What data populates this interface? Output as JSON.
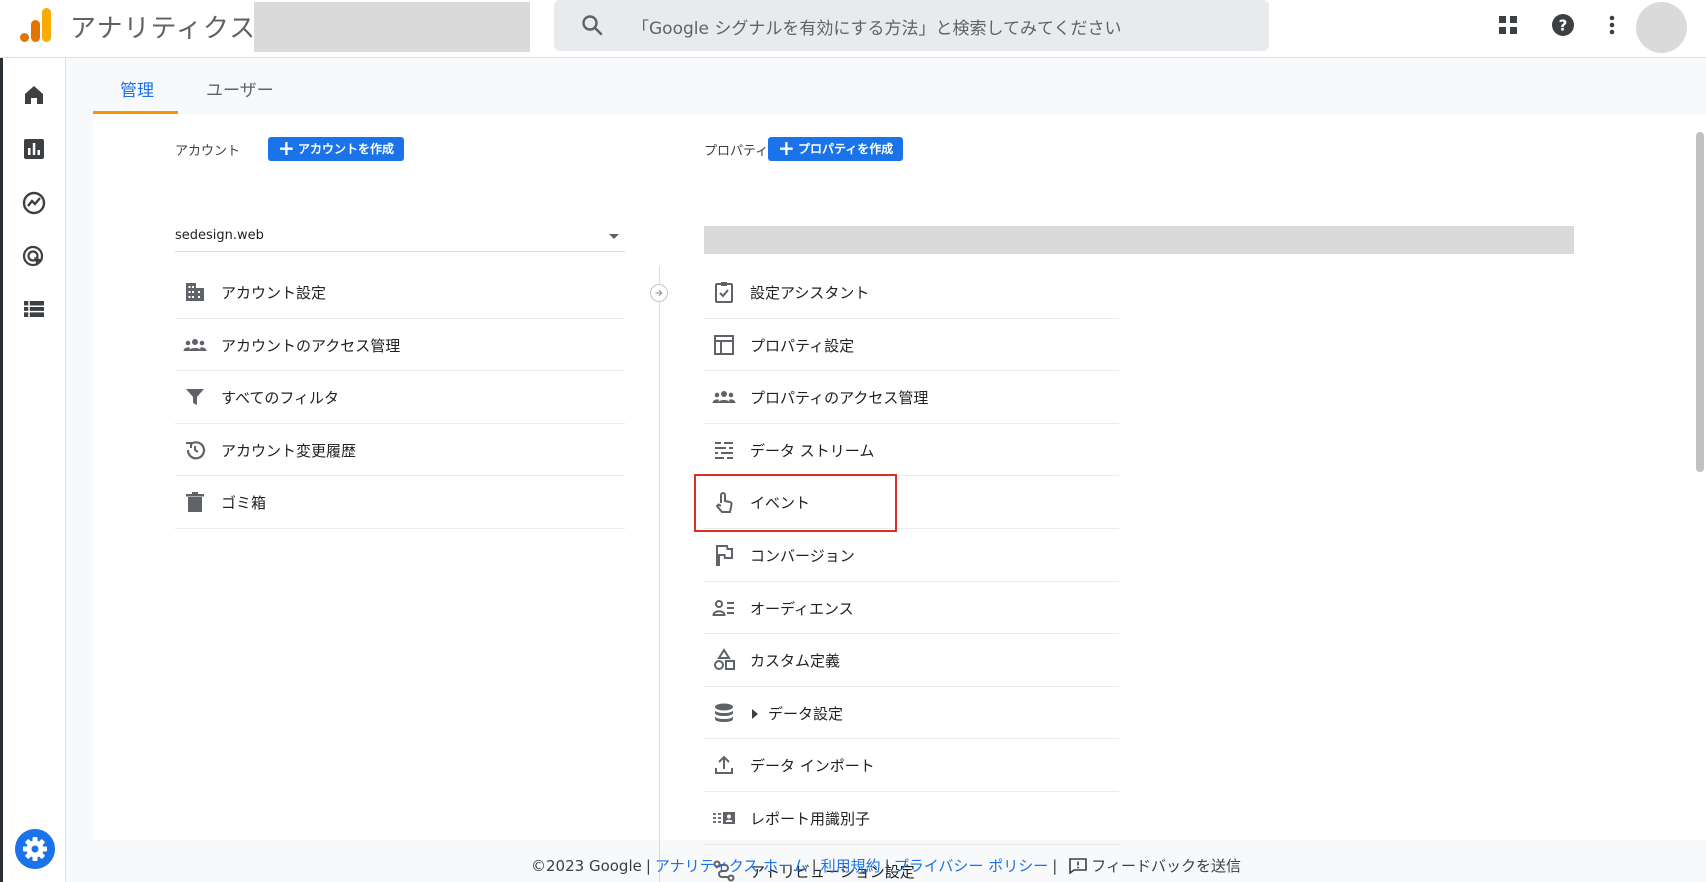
{
  "header": {
    "app_title": "アナリティクス",
    "search_placeholder": "「Google シグナルを有効にする方法」と検索してみてください"
  },
  "tabs": [
    {
      "label": "管理",
      "active": true
    },
    {
      "label": "ユーザー",
      "active": false
    }
  ],
  "account": {
    "label": "アカウント",
    "create_button": "アカウントを作成",
    "selected": "sedesign.web",
    "items": [
      {
        "label": "アカウント設定",
        "icon": "building-icon"
      },
      {
        "label": "アカウントのアクセス管理",
        "icon": "people-icon"
      },
      {
        "label": "すべてのフィルタ",
        "icon": "filter-icon"
      },
      {
        "label": "アカウント変更履歴",
        "icon": "history-icon"
      },
      {
        "label": "ゴミ箱",
        "icon": "trash-icon"
      }
    ]
  },
  "property": {
    "label": "プロパティ",
    "create_button": "プロパティを作成",
    "items": [
      {
        "label": "設定アシスタント",
        "icon": "checklist-icon"
      },
      {
        "label": "プロパティ設定",
        "icon": "layout-icon"
      },
      {
        "label": "プロパティのアクセス管理",
        "icon": "people-icon"
      },
      {
        "label": "データ ストリーム",
        "icon": "streams-icon"
      },
      {
        "label": "イベント",
        "icon": "touch-icon"
      },
      {
        "label": "コンバージョン",
        "icon": "flag-icon"
      },
      {
        "label": "オーディエンス",
        "icon": "audience-icon"
      },
      {
        "label": "カスタム定義",
        "icon": "shapes-icon"
      },
      {
        "label": "データ設定",
        "icon": "database-icon"
      },
      {
        "label": "データ インポート",
        "icon": "upload-icon"
      },
      {
        "label": "レポート用識別子",
        "icon": "identifier-icon"
      },
      {
        "label": "アトリビューション設定",
        "icon": "attribution-icon"
      }
    ]
  },
  "footer": {
    "copyright": "©2023 Google",
    "link_home": "アナリティクス ホーム",
    "link_terms": "利用規約",
    "link_privacy": "プライバシー ポリシー",
    "feedback": "フィードバックを送信"
  },
  "colors": {
    "accent": "#1a73e8",
    "tab_underline": "#f29900",
    "highlight": "#d93025"
  }
}
